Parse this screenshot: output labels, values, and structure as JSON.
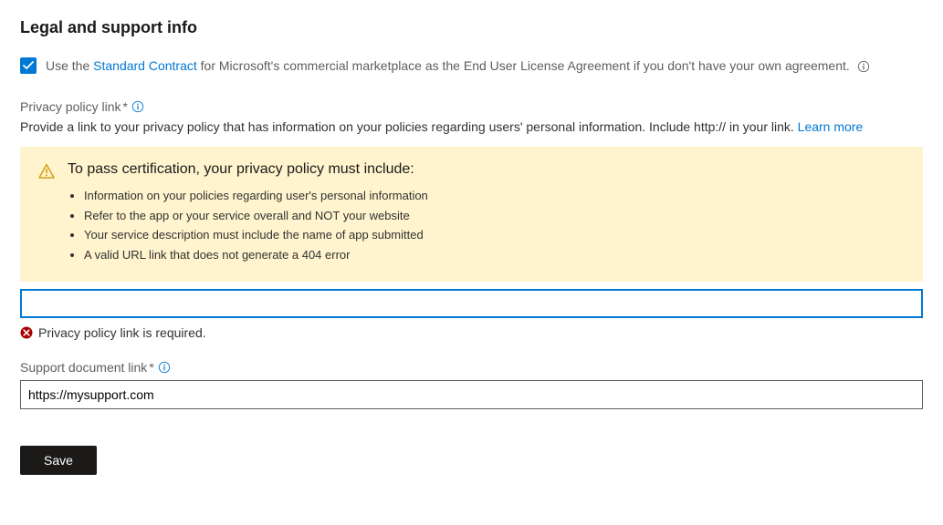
{
  "section_title": "Legal and support info",
  "checkbox": {
    "pre_text": "Use the ",
    "link_text": "Standard Contract",
    "post_text": " for Microsoft's commercial marketplace as the End User License Agreement if you don't have your own agreement.",
    "checked": true
  },
  "privacy_policy": {
    "label": "Privacy policy link",
    "required_mark": "*",
    "description_pre": "Provide a link to your privacy policy that has information on your policies regarding users' personal information. Include http:// in your link. ",
    "learn_more": "Learn more",
    "value": "",
    "error": "Privacy policy link is required."
  },
  "warning": {
    "title": "To pass certification, your privacy policy must include:",
    "items": [
      "Information on your policies regarding user's personal information",
      "Refer to the app or your service overall and NOT your website",
      "Your service description must include the name of app submitted",
      "A valid URL link that does not generate a 404 error"
    ]
  },
  "support_document": {
    "label": "Support document link",
    "required_mark": "*",
    "value": "https://mysupport.com"
  },
  "save_label": "Save"
}
